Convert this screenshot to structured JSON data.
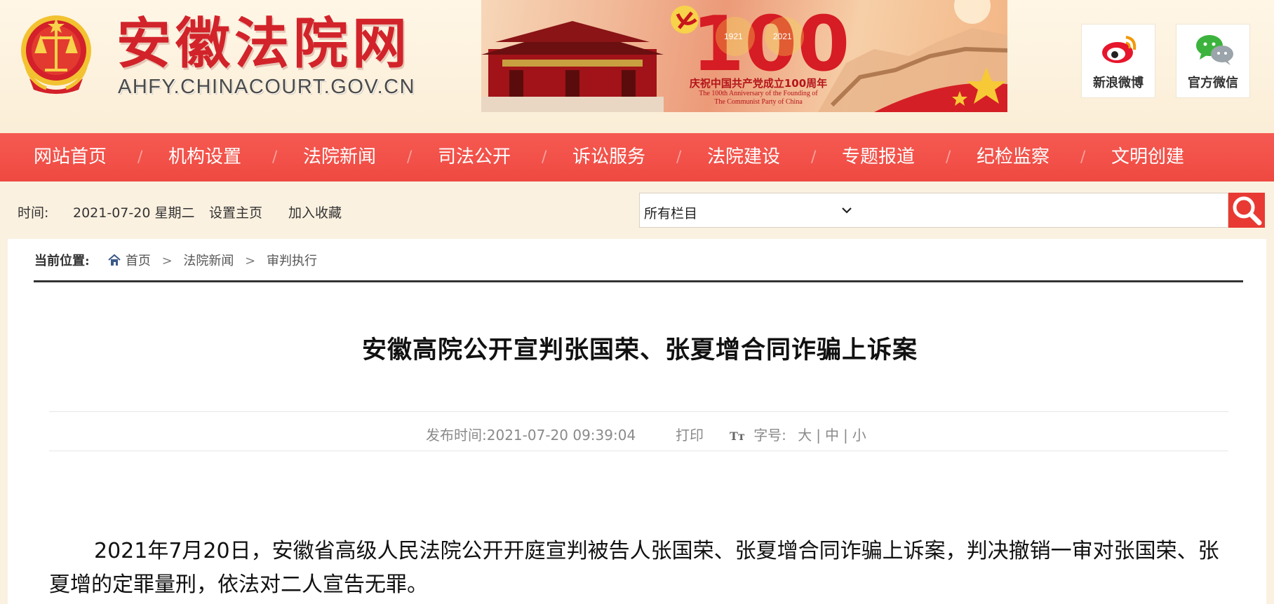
{
  "header": {
    "site_title": "安徽法院网",
    "site_domain": "AHFY.CHINACOURT.GOV.CN",
    "banner": {
      "caption_cn": "庆祝中国共产党成立100周年",
      "caption_en_1": "The 100th Anniversary of the Founding of",
      "caption_en_2": "The Communist Party of China",
      "number": "100",
      "year_start": "1921",
      "year_end": "2021"
    },
    "social": [
      {
        "label": "新浪微博",
        "icon": "weibo-icon"
      },
      {
        "label": "官方微信",
        "icon": "wechat-icon"
      }
    ]
  },
  "nav": {
    "items": [
      "网站首页",
      "机构设置",
      "法院新闻",
      "司法公开",
      "诉讼服务",
      "法院建设",
      "专题报道",
      "纪检监察",
      "文明创建"
    ],
    "separator": "/"
  },
  "toolbar": {
    "time_label": "时间:",
    "date": "2021-07-20 星期二",
    "set_home": "设置主页",
    "add_favorite": "加入收藏",
    "search_scope": "所有栏目"
  },
  "breadcrumb": {
    "label": "当前位置:",
    "items": [
      "首页",
      "法院新闻",
      "审判执行"
    ],
    "separator": ">"
  },
  "article": {
    "title": "安徽高院公开宣判张国荣、张夏增合同诈骗上诉案",
    "publish_label": "发布时间:",
    "publish_time": "2021-07-20 09:39:04",
    "print": "打印",
    "font_size_label": "字号:",
    "size_large": "大",
    "size_medium": "中",
    "size_small": "小",
    "paragraph_1": "2021年7月20日，安徽省高级人民法院公开开庭宣判被告人张国荣、张夏增合同诈骗上诉案，判决撤销一审对张国荣、张夏增的定罪量刑，依法对二人宣告无罪。"
  },
  "colors": {
    "brand_red": "#d2232a",
    "nav_red": "#f04a42",
    "page_bg": "#fbf1e0"
  }
}
